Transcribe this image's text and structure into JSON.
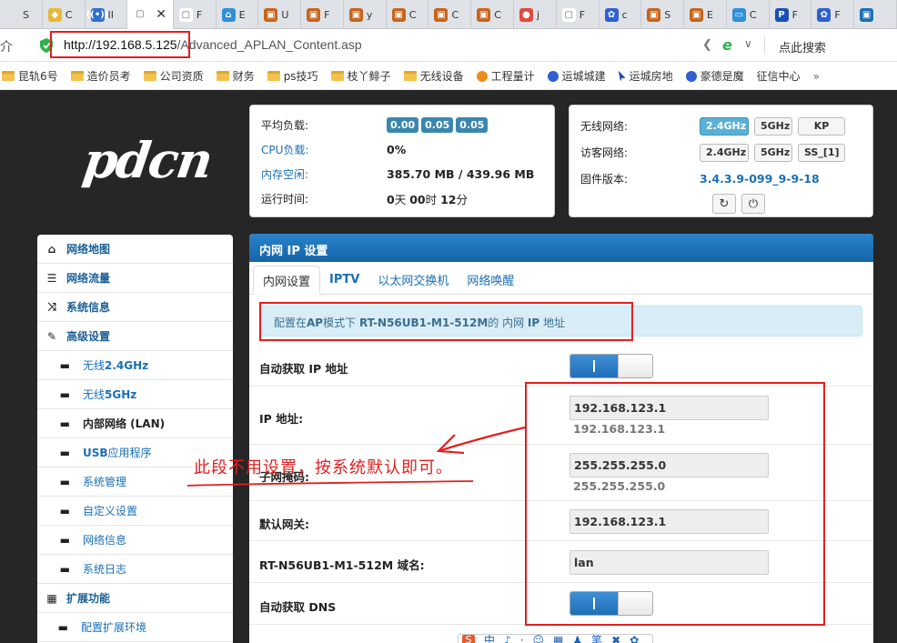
{
  "browser": {
    "tabs": [
      {
        "label": "S",
        "fav": "",
        "color": "#dfe3e8"
      },
      {
        "label": "C",
        "fav": "◆",
        "color": "#e8b838"
      },
      {
        "label": "II",
        "fav": "((•))",
        "color": "#2f6fd0"
      },
      {
        "label": "",
        "fav": "▢",
        "color": "#ffffff",
        "active": true
      },
      {
        "label": "F",
        "fav": "▢",
        "color": "#ffffff"
      },
      {
        "label": "E",
        "fav": "⌂",
        "color": "#2f8fd8"
      },
      {
        "label": "U",
        "fav": "▣",
        "color": "#c8641c"
      },
      {
        "label": "F",
        "fav": "▣",
        "color": "#c8641c"
      },
      {
        "label": "y",
        "fav": "▣",
        "color": "#c8641c"
      },
      {
        "label": "C",
        "fav": "▣",
        "color": "#c8641c"
      },
      {
        "label": "C",
        "fav": "▣",
        "color": "#c8641c"
      },
      {
        "label": "C",
        "fav": "▣",
        "color": "#c8641c"
      },
      {
        "label": "j",
        "fav": "●",
        "color": "#e04a3a"
      },
      {
        "label": "F",
        "fav": "▢",
        "color": "#ffffff"
      },
      {
        "label": "c",
        "fav": "✿",
        "color": "#2f5fd0"
      },
      {
        "label": "S",
        "fav": "▣",
        "color": "#c8641c"
      },
      {
        "label": "E",
        "fav": "▣",
        "color": "#c8641c"
      },
      {
        "label": "C",
        "fav": "▭",
        "color": "#2f8fd8"
      },
      {
        "label": "F",
        "fav": "P",
        "color": "#1a4fb8"
      },
      {
        "label": "F",
        "fav": "✿",
        "color": "#2f5fd0"
      },
      {
        "label": "",
        "fav": "▣",
        "color": "#1a6fb6"
      }
    ],
    "close_glyph": "✕",
    "back_glyph": "介",
    "url_host": "http://192.168.5.125",
    "url_path": "/Advanced_APLAN_Content.asp",
    "share_glyph": "❮",
    "e_glyph": "e",
    "chevron_glyph": "∨",
    "search_label": "点此搜索",
    "bookmarks": [
      {
        "label": "昆轨6号",
        "icon": "folder"
      },
      {
        "label": "造价员考",
        "icon": "folder"
      },
      {
        "label": "公司资质",
        "icon": "folder"
      },
      {
        "label": "财务",
        "icon": "folder"
      },
      {
        "label": "ps技巧",
        "icon": "folder"
      },
      {
        "label": "枝丫鲱子",
        "icon": "folder"
      },
      {
        "label": "无线设备",
        "icon": "folder"
      },
      {
        "label": "工程量计",
        "icon": "sun"
      },
      {
        "label": "运城城建",
        "icon": "paw"
      },
      {
        "label": "运城房地",
        "icon": "cursor"
      },
      {
        "label": "豪德是魔",
        "icon": "paw"
      },
      {
        "label": "征信中心",
        "icon": "page"
      }
    ],
    "bookmarks_more": "»"
  },
  "logo": "pdcn",
  "status": {
    "load_label": "平均负载:",
    "load_values": [
      "0.00",
      "0.05",
      "0.05"
    ],
    "cpu_label": "CPU负载:",
    "cpu_value": "0%",
    "mem_label": "内存空闲:",
    "mem_value": "385.70 MB / 439.96 MB",
    "uptime_label": "运行时间:",
    "uptime_days": "0",
    "uptime_days_unit": "天 ",
    "uptime_hours": "00",
    "uptime_hours_unit": "时 ",
    "uptime_mins": "12",
    "uptime_mins_unit": "分"
  },
  "wifi": {
    "wireless_label": "无线网络:",
    "wireless_buttons": [
      "2.4GHz",
      "5GHz",
      "KP"
    ],
    "guest_label": "访客网络:",
    "guest_buttons": [
      "2.4GHz",
      "5GHz",
      "SS_[1]"
    ],
    "firmware_label": "固件版本:",
    "firmware_value": "3.4.3.9-099_9-9-18",
    "refresh_glyph": "↻",
    "power_glyph": "⏻"
  },
  "sidebar": {
    "items": [
      {
        "icon": "⌂",
        "name": "network-map",
        "label": "网络地图"
      },
      {
        "icon": "☰",
        "name": "traffic",
        "label": "网络流量"
      },
      {
        "icon": "⤨",
        "name": "system-info",
        "label": "系统信息"
      },
      {
        "icon": "✎",
        "name": "advanced",
        "label": "高级设置"
      }
    ],
    "subitems": [
      {
        "name": "wireless-24",
        "prefix": "无线 ",
        "bold": "2.4GHz"
      },
      {
        "name": "wireless-5",
        "prefix": "无线 ",
        "bold": "5GHz"
      },
      {
        "name": "lan",
        "prefix": "内部网络 (LAN)",
        "bold": "",
        "active": true
      },
      {
        "name": "usb",
        "prefix": "",
        "bold": "USB",
        "suffix": " 应用程序"
      },
      {
        "name": "sys-admin",
        "prefix": "系统管理",
        "bold": ""
      },
      {
        "name": "custom",
        "prefix": "自定义设置",
        "bold": ""
      },
      {
        "name": "net-info",
        "prefix": "网络信息",
        "bold": ""
      },
      {
        "name": "syslog",
        "prefix": "系统日志",
        "bold": ""
      }
    ],
    "ext_icon": "▦",
    "ext_label": "扩展功能",
    "ext_sub": "配置扩展环境",
    "dash": "▬"
  },
  "panel": {
    "title": "内网 IP 设置",
    "tabs": [
      {
        "label": "内网设置",
        "active": true
      },
      {
        "label": "IPTV",
        "bold": true
      },
      {
        "label": "以太网交换机"
      },
      {
        "label": "网络唤醒"
      }
    ],
    "info_pre": "配置在",
    "info_ap": "AP",
    "info_mid": "模式下 ",
    "info_model": "RT-N56UB1-M1-512M",
    "info_mid2": "的 内网 ",
    "info_ip": "IP",
    "info_post": " 地址",
    "dhcp_label": "自动获取 IP 地址",
    "ip_label": "IP 地址:",
    "ip_value": "192.168.123.1",
    "ip_hint": "192.168.123.1",
    "mask_label": "子网掩码:",
    "mask_value": "255.255.255.0",
    "mask_hint": "255.255.255.0",
    "gw_label": "默认网关:",
    "gw_value": "192.168.123.1",
    "domain_label": "RT-N56UB1-M1-512M 域名:",
    "domain_value": "lan",
    "dns_label": "自动获取 DNS"
  },
  "annotation": "此段不用设置，按系统默认即可。",
  "ime": [
    "S",
    "中",
    "♪",
    "·",
    "☺",
    "▦",
    "♟",
    "笔",
    "✖",
    "✿"
  ]
}
